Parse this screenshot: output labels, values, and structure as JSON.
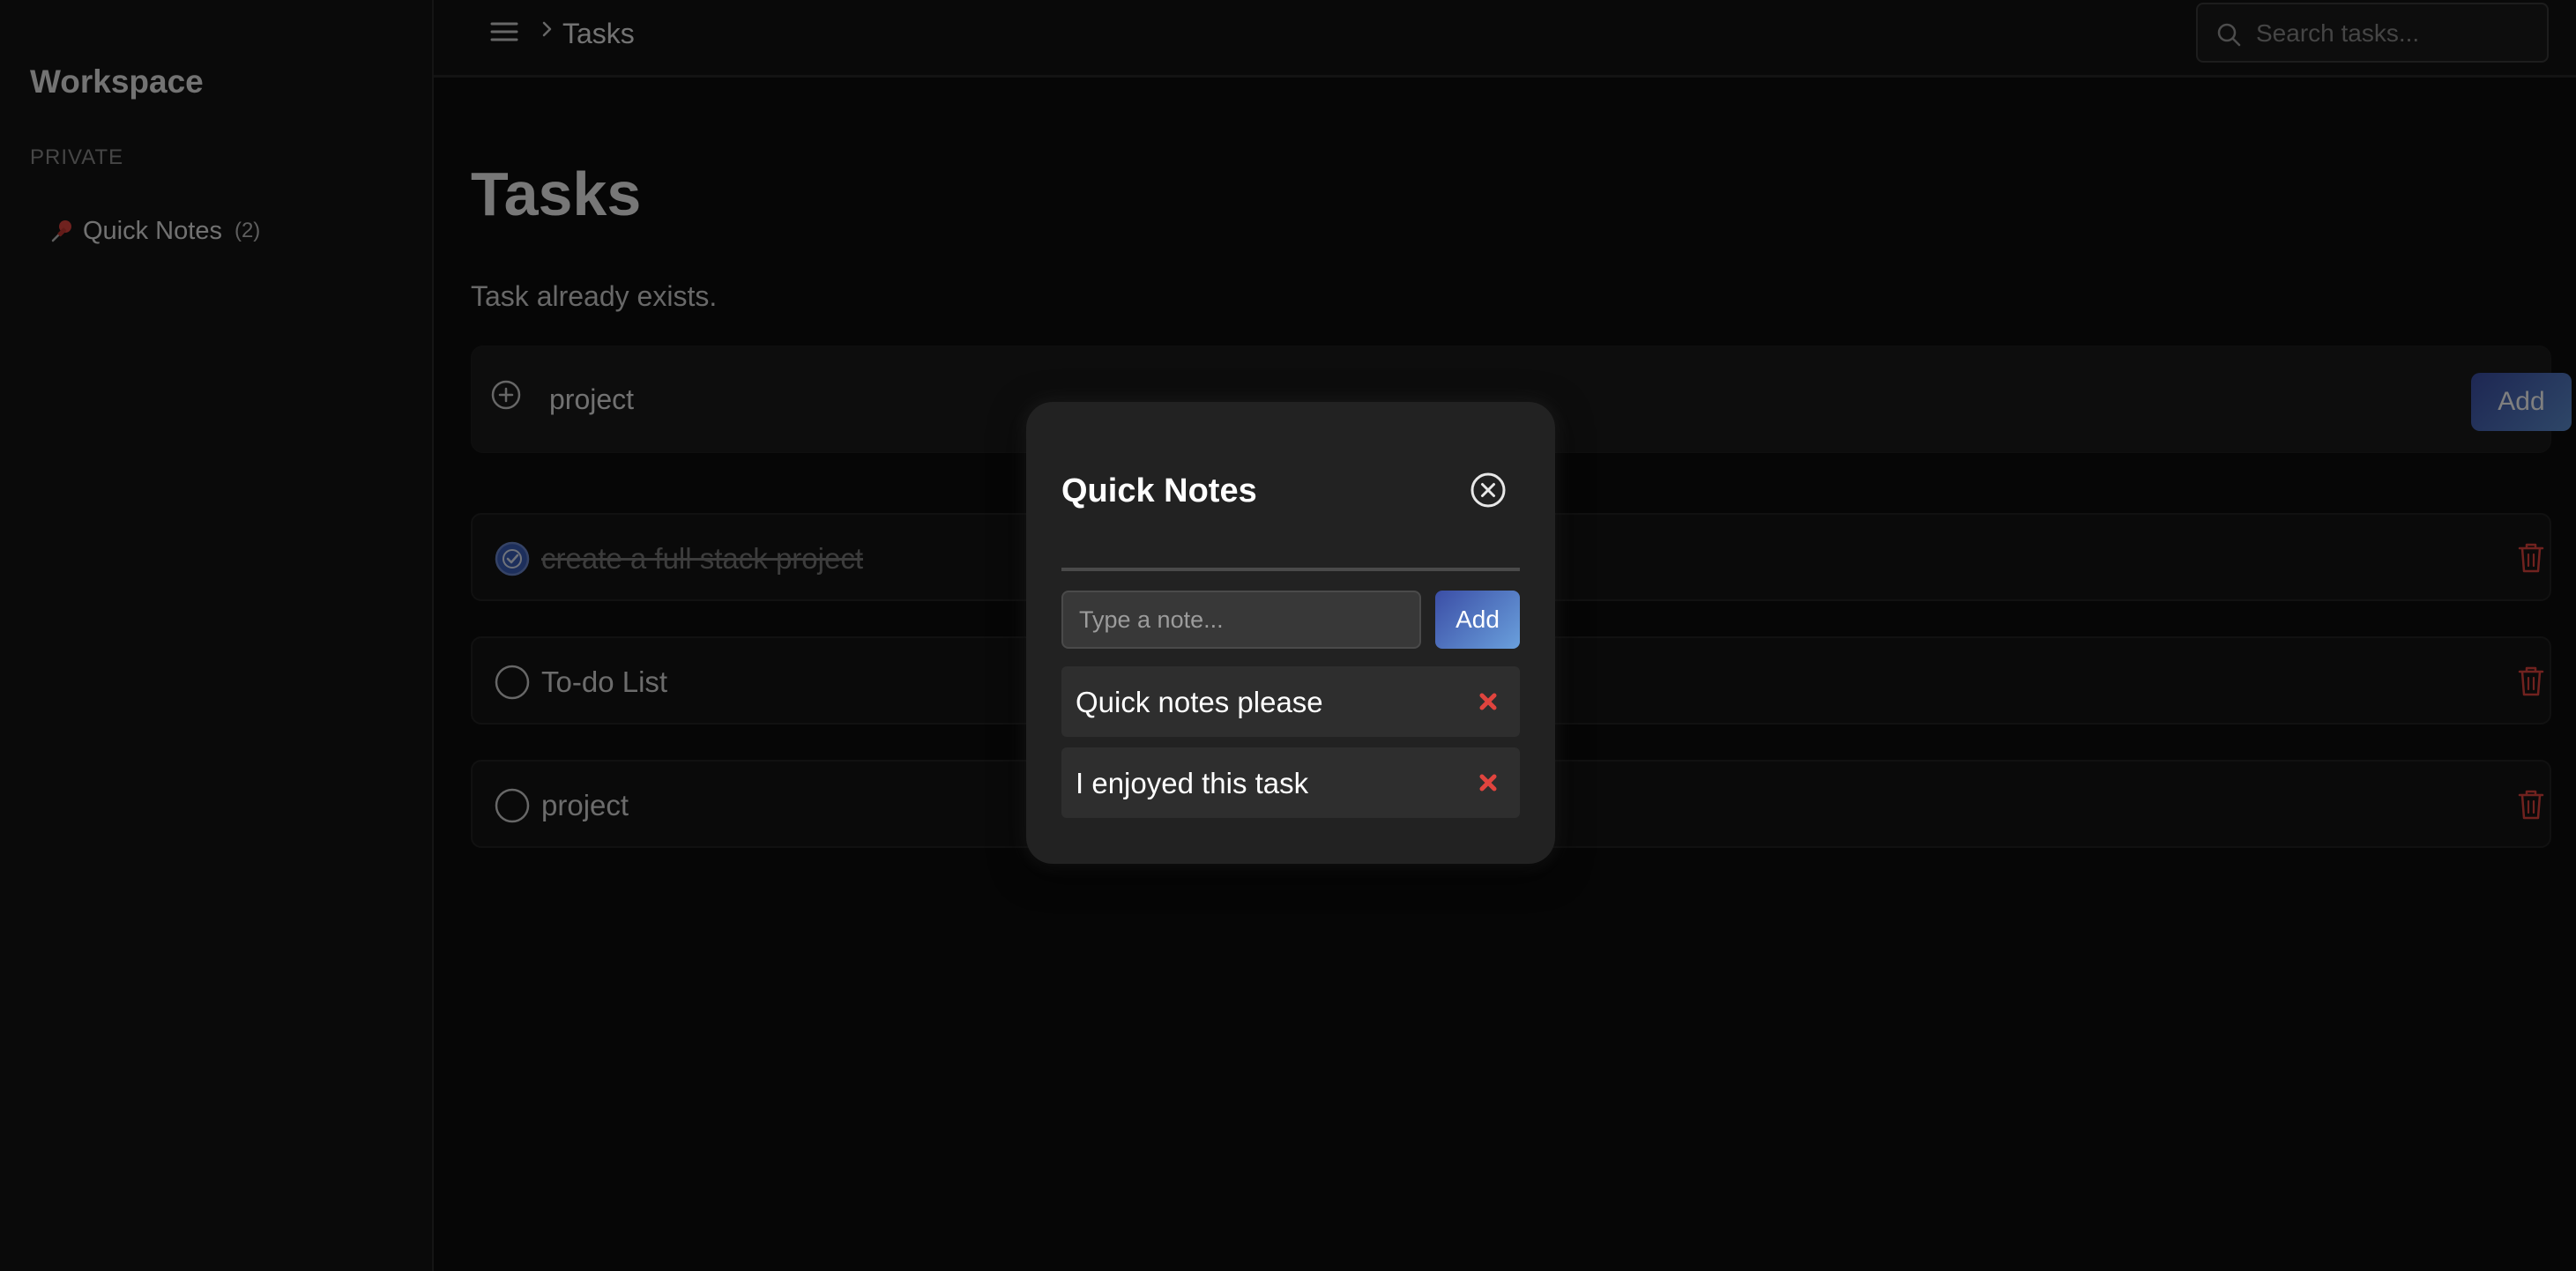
{
  "sidebar": {
    "workspace_title": "Workspace",
    "section_label": "PRIVATE",
    "items": [
      {
        "icon": "pin-icon",
        "label": "Quick Notes",
        "count": "(2)"
      }
    ]
  },
  "header": {
    "breadcrumb": "Tasks",
    "search_placeholder": "Search tasks..."
  },
  "main": {
    "title": "Tasks",
    "status_message": "Task already exists.",
    "new_task": {
      "value": "project",
      "add_label": "Add"
    },
    "tasks": [
      {
        "text": "create a full stack project",
        "done": true
      },
      {
        "text": "To-do List",
        "done": false
      },
      {
        "text": "project",
        "done": false
      }
    ]
  },
  "modal": {
    "title": "Quick Notes",
    "input_placeholder": "Type a note...",
    "add_label": "Add",
    "notes": [
      {
        "text": "Quick notes please"
      },
      {
        "text": "I enjoyed this task"
      }
    ]
  },
  "colors": {
    "accent_gradient_start": "#3b4ea6",
    "accent_gradient_end": "#5d8ed0",
    "danger": "#e0443e",
    "background": "#0b0b0b"
  }
}
